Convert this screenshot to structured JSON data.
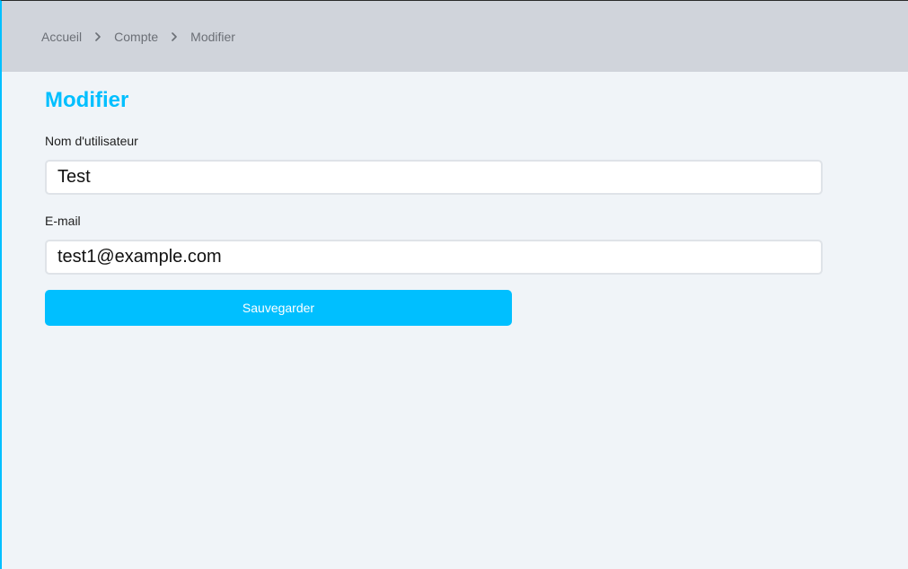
{
  "breadcrumb": {
    "items": [
      {
        "label": "Accueil"
      },
      {
        "label": "Compte"
      },
      {
        "label": "Modifier"
      }
    ]
  },
  "page": {
    "title": "Modifier"
  },
  "form": {
    "username": {
      "label": "Nom d'utilisateur",
      "value": "Test"
    },
    "email": {
      "label": "E-mail",
      "value": "test1@example.com"
    },
    "save_label": "Sauvegarder"
  },
  "icons": {
    "separator": "chevron-right-icon"
  },
  "colors": {
    "accent": "#00bfff",
    "topbar": "#d0d4db",
    "background": "#f0f4f8"
  }
}
